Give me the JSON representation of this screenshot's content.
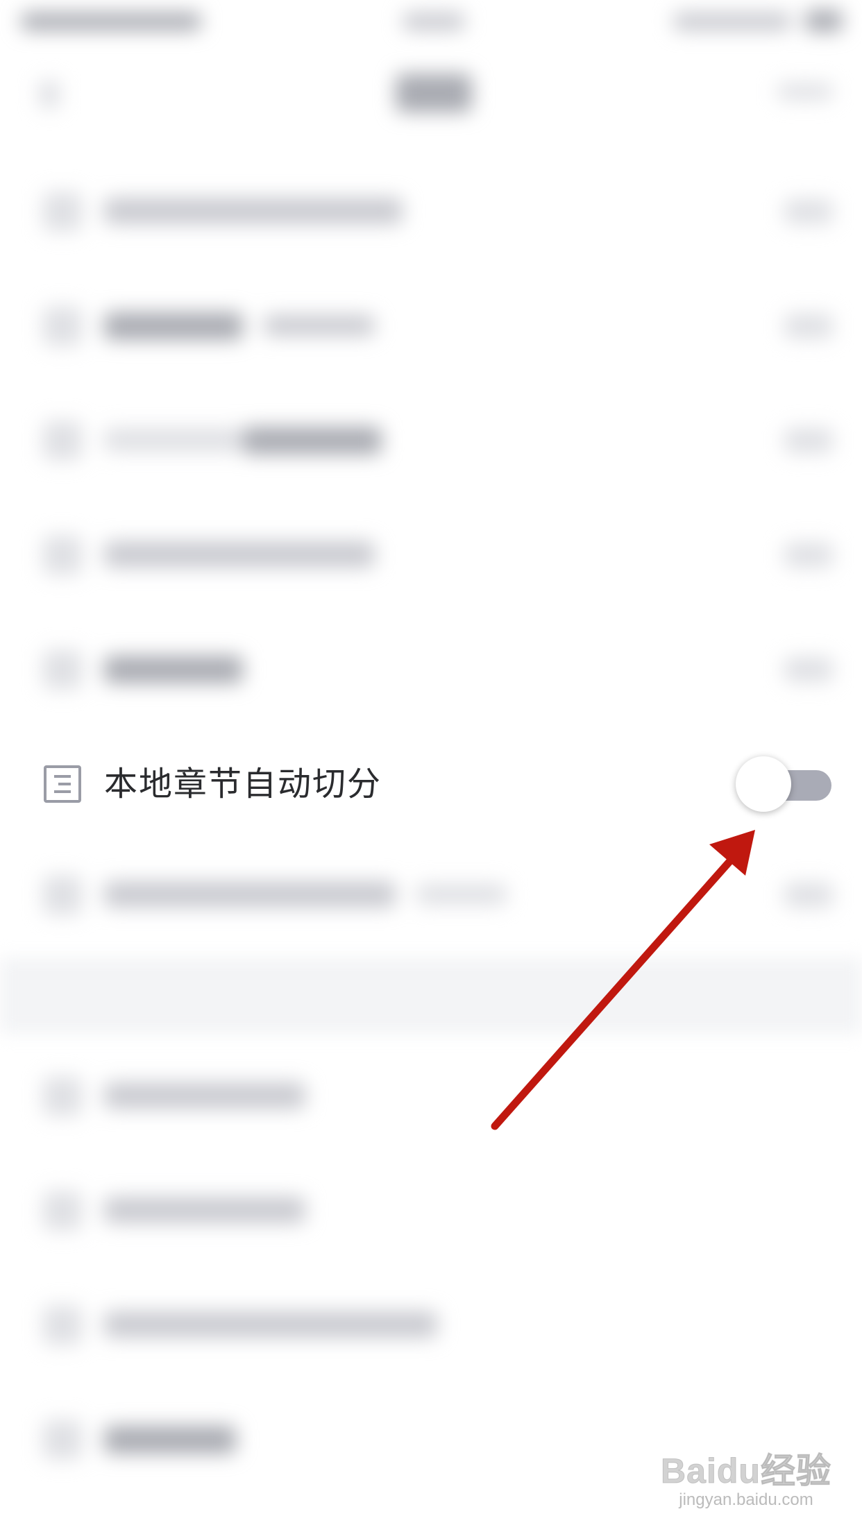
{
  "setting": {
    "label": "本地章节自动切分",
    "toggle_state": "off",
    "icon": "document-list-icon"
  },
  "colors": {
    "label_text": "#2a2b2e",
    "toggle_track_off": "#a9abb6",
    "toggle_thumb": "#ffffff",
    "annotation_arrow": "#c0180f",
    "icon_stroke": "#9a9ca6"
  },
  "watermark": {
    "logo": "Baidu经验",
    "url": "jingyan.baidu.com"
  }
}
